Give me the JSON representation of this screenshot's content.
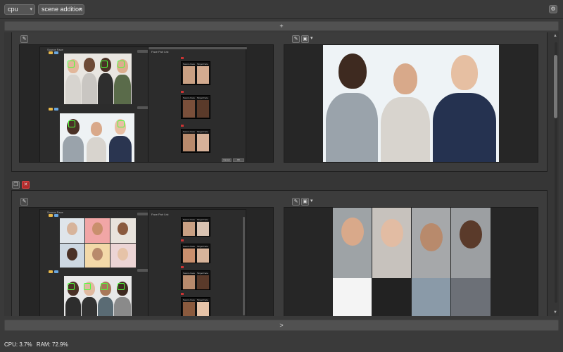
{
  "toolbar": {
    "device_select": "cpu",
    "mode_select": "scene addition",
    "settings_icon": "gear-icon"
  },
  "add_button_label": "+",
  "run_button_label": ">",
  "cards": [
    {
      "left_list_title": "Face Pair List",
      "source_label": "Source Face",
      "target_label": "Target Face",
      "cancel_label": "Cancel",
      "ok_label": "OK",
      "mini_label_1": "Source Face",
      "mini_label_2": "Target Face"
    },
    {
      "left_list_title": "Face Pair List",
      "source_label": "Source Face",
      "target_label": "Target Face",
      "mini_label_1": "Source Face",
      "mini_label_2": "Target Face"
    }
  ],
  "status": {
    "cpu": "CPU: 3.7%",
    "ram": "RAM: 72.9%"
  },
  "colors": {
    "background": "#3a3a3a",
    "panel": "#262626",
    "accent_green": "#4dff3a",
    "delete_red": "#b02a2a"
  }
}
